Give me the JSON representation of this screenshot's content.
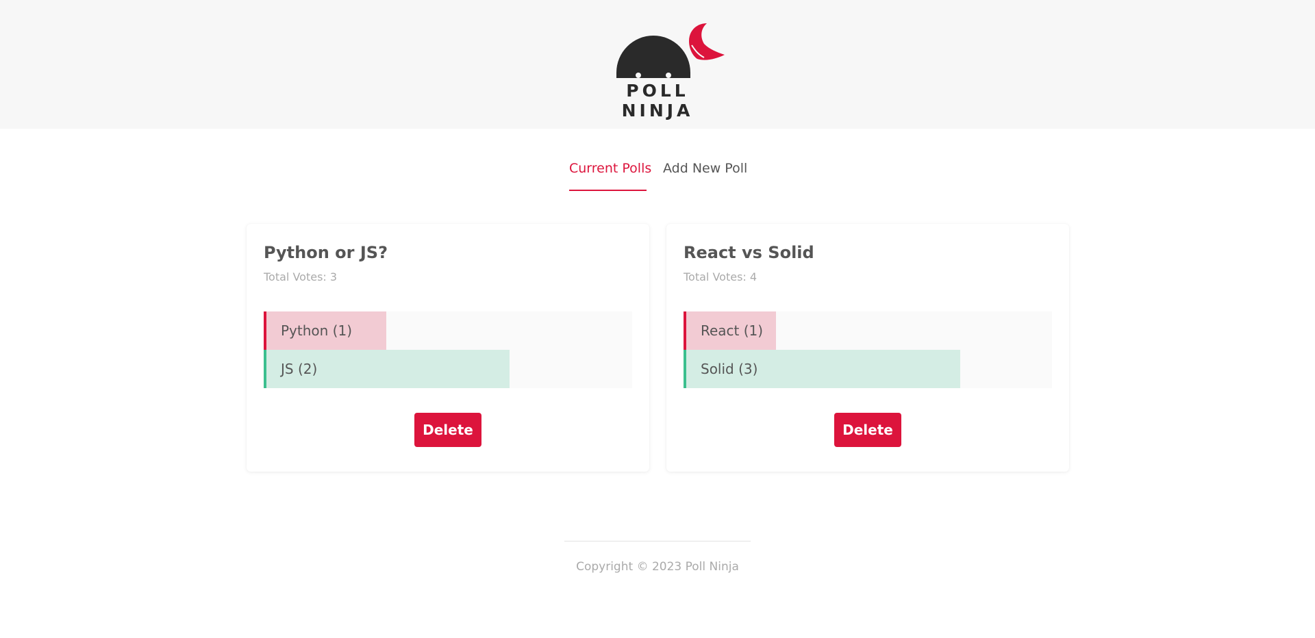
{
  "header": {
    "logo_text": "POLL NINJA",
    "colors": {
      "background": "#f7f7f7",
      "logo_head": "#2a2a2a",
      "logo_bandana": "#dc143c"
    }
  },
  "nav": {
    "tabs": [
      {
        "label": "Current Polls",
        "active": true
      },
      {
        "label": "Add New Poll",
        "active": false
      }
    ],
    "accent_color": "#dc143c"
  },
  "polls": [
    {
      "title": "Python or JS?",
      "total_votes_text": "Total Votes: 3",
      "options": [
        {
          "label": "Python (1)",
          "votes": 1,
          "fraction": 0.333,
          "color": "#dc143c"
        },
        {
          "label": "JS (2)",
          "votes": 2,
          "fraction": 0.667,
          "color": "#3bbf8e"
        }
      ],
      "delete_label": "Delete"
    },
    {
      "title": "React vs Solid",
      "total_votes_text": "Total Votes: 4",
      "options": [
        {
          "label": "React (1)",
          "votes": 1,
          "fraction": 0.25,
          "color": "#dc143c"
        },
        {
          "label": "Solid (3)",
          "votes": 3,
          "fraction": 0.75,
          "color": "#3bbf8e"
        }
      ],
      "delete_label": "Delete"
    }
  ],
  "footer": {
    "copyright": "Copyright © 2023 Poll Ninja"
  }
}
